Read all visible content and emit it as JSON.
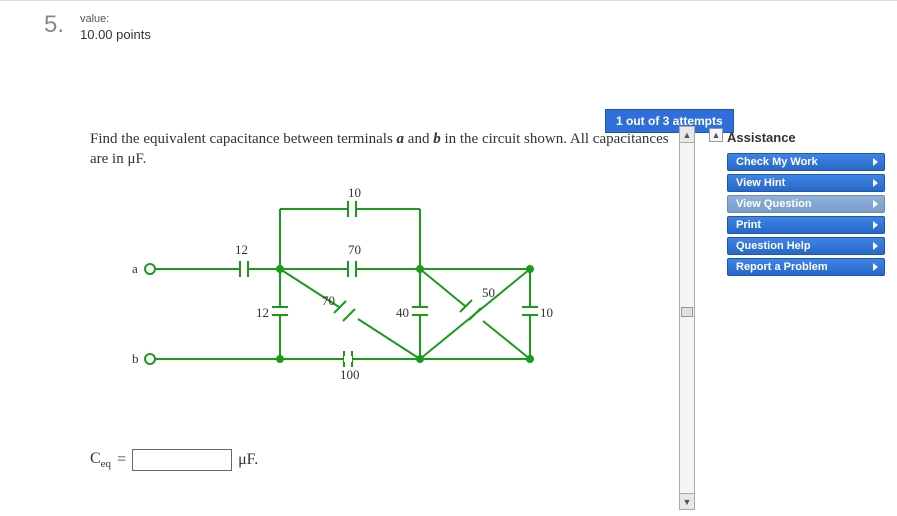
{
  "question": {
    "number": "5.",
    "value_label": "value:",
    "points": "10.00 points",
    "attempts_badge": "1 out of 3 attempts",
    "prompt_html_parts": {
      "p1": "Find the equivalent capacitance between terminals ",
      "a": "a",
      "p2": " and ",
      "b": "b",
      "p3": " in the circuit shown. All capacitances are in μF."
    }
  },
  "circuit_labels": {
    "a": "a",
    "b": "b",
    "c10": "10",
    "c70top": "70",
    "c12left": "12",
    "c12mid": "12",
    "c70mid": "70",
    "c40": "40",
    "c50": "50",
    "c10right": "10",
    "c100": "100"
  },
  "answer": {
    "symbol": "C",
    "sub": "eq",
    "eq": "=",
    "value": "",
    "unit": "μF."
  },
  "assistance": {
    "header": "Assistance",
    "buttons": [
      {
        "label": "Check My Work",
        "muted": false
      },
      {
        "label": "View Hint",
        "muted": false
      },
      {
        "label": "View Question",
        "muted": true
      },
      {
        "label": "Print",
        "muted": false
      },
      {
        "label": "Question Help",
        "muted": false
      },
      {
        "label": "Report a Problem",
        "muted": false
      }
    ]
  }
}
